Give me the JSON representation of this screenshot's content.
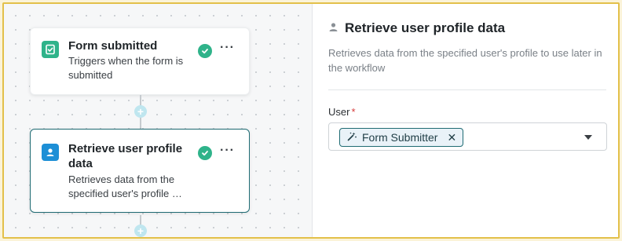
{
  "workflow": {
    "steps": [
      {
        "title": "Form submitted",
        "description": "Triggers when the form is submitted",
        "icon": "form-check-icon",
        "status": "complete"
      },
      {
        "title": "Retrieve user profile data",
        "description": "Retrieves data from the specified user's profile …",
        "icon": "user-icon",
        "status": "complete"
      }
    ],
    "add_step_symbol": "+",
    "more_symbol": "···"
  },
  "panel": {
    "title": "Retrieve user profile data",
    "title_icon": "person-icon",
    "description": "Retrieves data from the specified user's profile to use later in the workflow",
    "field": {
      "label": "User",
      "required_marker": "*",
      "chip_label": "Form Submitter",
      "chip_icon": "magic-wand-icon",
      "chip_remove": "✕"
    }
  },
  "colors": {
    "accent": "#1f6b73",
    "success": "#2fb38a",
    "highlight_border": "#e3c04a"
  }
}
